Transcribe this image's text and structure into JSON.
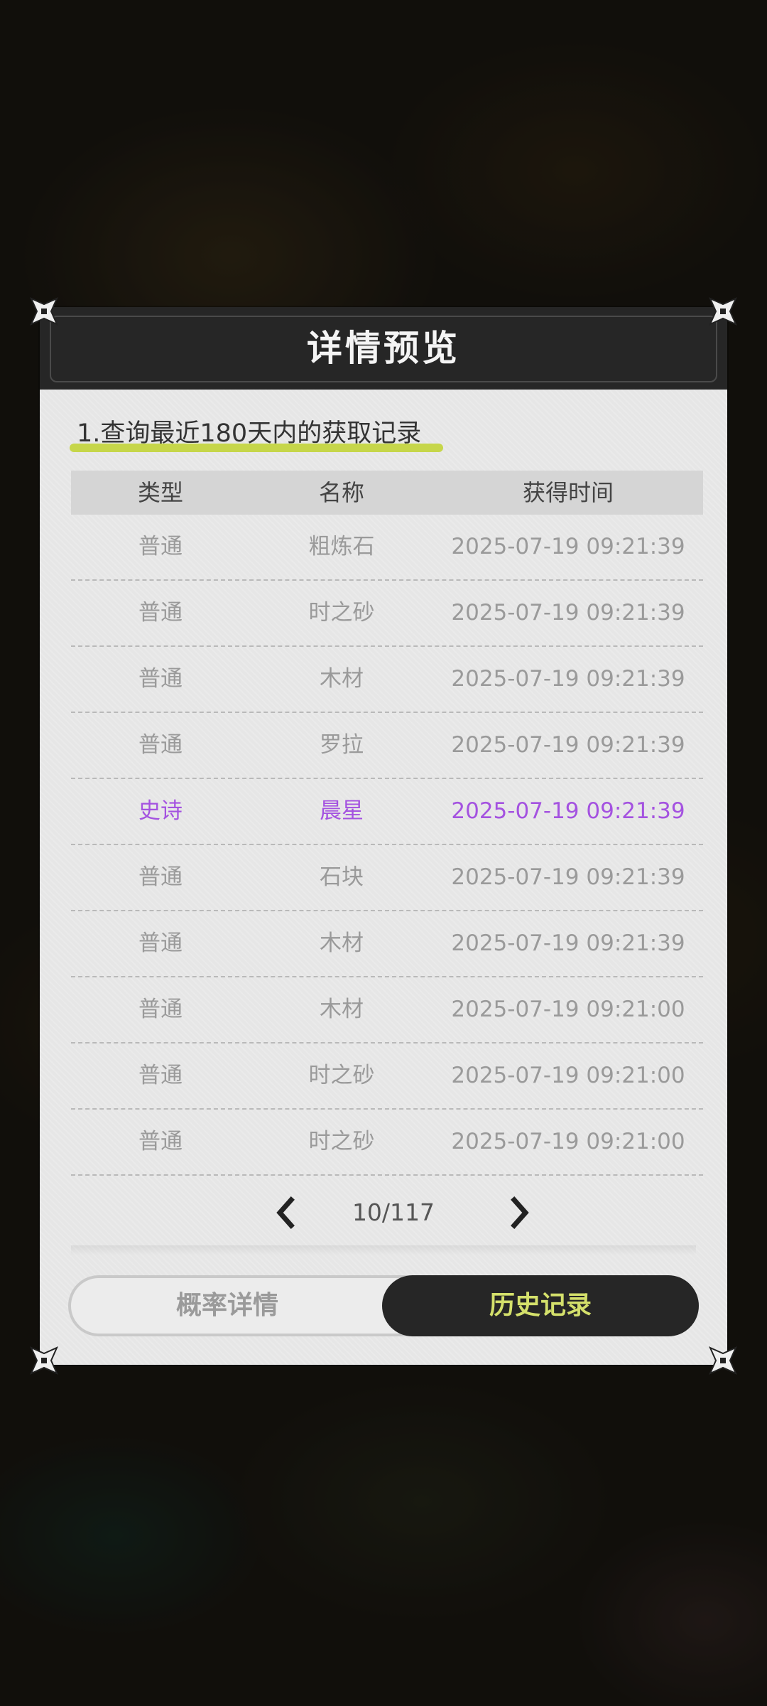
{
  "dialog": {
    "title": "详情预览",
    "section_heading": "1.查询最近180天内的获取记录"
  },
  "table": {
    "headers": [
      "类型",
      "名称",
      "获得时间"
    ],
    "rows": [
      {
        "type": "普通",
        "name": "粗炼石",
        "time": "2025-07-19 09:21:39",
        "rarity": "normal"
      },
      {
        "type": "普通",
        "name": "时之砂",
        "time": "2025-07-19 09:21:39",
        "rarity": "normal"
      },
      {
        "type": "普通",
        "name": "木材",
        "time": "2025-07-19 09:21:39",
        "rarity": "normal"
      },
      {
        "type": "普通",
        "name": "罗拉",
        "time": "2025-07-19 09:21:39",
        "rarity": "normal"
      },
      {
        "type": "史诗",
        "name": "晨星",
        "time": "2025-07-19 09:21:39",
        "rarity": "epic"
      },
      {
        "type": "普通",
        "name": "石块",
        "time": "2025-07-19 09:21:39",
        "rarity": "normal"
      },
      {
        "type": "普通",
        "name": "木材",
        "time": "2025-07-19 09:21:39",
        "rarity": "normal"
      },
      {
        "type": "普通",
        "name": "木材",
        "time": "2025-07-19 09:21:00",
        "rarity": "normal"
      },
      {
        "type": "普通",
        "name": "时之砂",
        "time": "2025-07-19 09:21:00",
        "rarity": "normal"
      },
      {
        "type": "普通",
        "name": "时之砂",
        "time": "2025-07-19 09:21:00",
        "rarity": "normal"
      }
    ]
  },
  "pagination": {
    "label": "10/117",
    "prev_icon": "chevron-left-icon",
    "next_icon": "chevron-right-icon"
  },
  "tabs": {
    "left_label": "概率详情",
    "right_label": "历史记录",
    "active": "right"
  },
  "colors": {
    "epic": "#a452e0",
    "normal_text": "#9a9a9a",
    "accent_underline": "#c6d64a",
    "active_tab_text": "#d4e06b",
    "dark": "#262626"
  }
}
